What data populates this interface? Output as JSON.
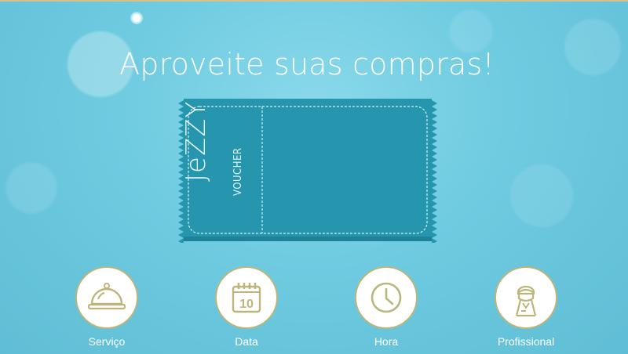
{
  "headline": "Aproveite suas compras!",
  "voucher": {
    "brand": "JeZZY",
    "subtitle": "VOUCHER"
  },
  "features": [
    {
      "label": "Serviço",
      "icon": "cloche-icon"
    },
    {
      "label": "Data",
      "icon": "calendar-icon",
      "calendar_day": "10"
    },
    {
      "label": "Hora",
      "icon": "clock-icon"
    },
    {
      "label": "Profissional",
      "icon": "professional-icon"
    }
  ],
  "colors": {
    "icon": "#bdb57b",
    "voucher": "#2596ad",
    "voucher_edge": "#1f8197"
  }
}
